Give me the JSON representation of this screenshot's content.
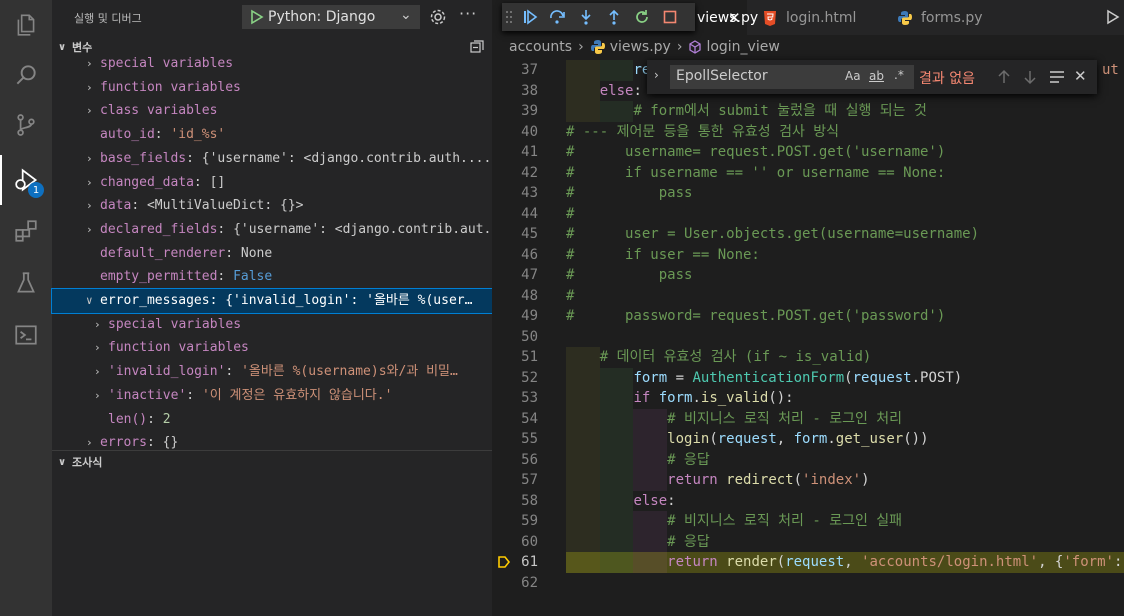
{
  "activity_bar": {
    "items": [
      {
        "name": "explorer",
        "icon": "files-icon"
      },
      {
        "name": "search",
        "icon": "search-icon"
      },
      {
        "name": "source-control",
        "icon": "source-control-icon"
      },
      {
        "name": "run-and-debug",
        "icon": "run-debug-icon",
        "badge": "1"
      },
      {
        "name": "extensions",
        "icon": "extensions-icon"
      },
      {
        "name": "testing",
        "icon": "flask-icon"
      },
      {
        "name": "remote-explorer",
        "icon": "terminal-icon"
      }
    ]
  },
  "sidebar": {
    "title": "실행 및 디버그",
    "config": "Python: Django",
    "variables_header": "변수",
    "watch_header": "조사식",
    "variables": [
      {
        "indent": 1,
        "twisty": ">",
        "name": "special variables",
        "value": "",
        "kind": "scope"
      },
      {
        "indent": 1,
        "twisty": ">",
        "name": "function variables",
        "value": "",
        "kind": "scope"
      },
      {
        "indent": 1,
        "twisty": ">",
        "name": "class variables",
        "value": "",
        "kind": "scope"
      },
      {
        "indent": 1,
        "twisty": "",
        "name": "auto_id",
        "value": "'id_%s'",
        "kind": "str"
      },
      {
        "indent": 1,
        "twisty": ">",
        "name": "base_fields",
        "value": "{'username': <django.contrib.auth....",
        "kind": "plain"
      },
      {
        "indent": 1,
        "twisty": ">",
        "name": "changed_data",
        "value": "[]",
        "kind": "plain"
      },
      {
        "indent": 1,
        "twisty": ">",
        "name": "data",
        "value": "<MultiValueDict: {}>",
        "kind": "plain"
      },
      {
        "indent": 1,
        "twisty": ">",
        "name": "declared_fields",
        "value": "{'username': <django.contrib.aut...",
        "kind": "plain"
      },
      {
        "indent": 1,
        "twisty": "",
        "name": "default_renderer",
        "value": "None",
        "kind": "plain"
      },
      {
        "indent": 1,
        "twisty": "",
        "name": "empty_permitted",
        "value": "False",
        "kind": "kw"
      },
      {
        "indent": 1,
        "twisty": "v",
        "name": "error_messages",
        "value": "{'invalid_login': '올바른 %(user…",
        "kind": "plain",
        "selected": true
      },
      {
        "indent": 2,
        "twisty": ">",
        "name": "special variables",
        "value": "",
        "kind": "scope"
      },
      {
        "indent": 2,
        "twisty": ">",
        "name": "function variables",
        "value": "",
        "kind": "scope"
      },
      {
        "indent": 2,
        "twisty": ">",
        "name": "'invalid_login'",
        "value": "'올바른 %(username)s와/과 비밀…",
        "kind": "str"
      },
      {
        "indent": 2,
        "twisty": ">",
        "name": "'inactive'",
        "value": "'이 계정은 유효하지 않습니다.'",
        "kind": "str"
      },
      {
        "indent": 2,
        "twisty": "",
        "name": "len()",
        "value": "2",
        "kind": "num"
      },
      {
        "indent": 1,
        "twisty": ">",
        "name": "errors",
        "value": "{}",
        "kind": "plain"
      }
    ]
  },
  "editor": {
    "tabs": [
      {
        "label": "views.py",
        "icon": "python-icon",
        "active": true
      },
      {
        "label": "login.html",
        "icon": "html-icon"
      },
      {
        "label": "forms.py",
        "icon": "python-icon"
      }
    ],
    "breadcrumb": [
      "accounts",
      "views.py",
      "login_view"
    ],
    "find": {
      "query": "EpollSelector",
      "options": [
        "Aa",
        "ab",
        ".*"
      ],
      "result": "결과 없음"
    },
    "lines": [
      {
        "n": "37",
        "tokens": [
          [
            "re",
            "var"
          ]
        ],
        "indent": 4,
        "tail": [
          [
            "ut",
            "str"
          ]
        ]
      },
      {
        "n": "38",
        "tokens": [
          [
            "else",
            "kw"
          ],
          [
            ":",
            "pl"
          ]
        ],
        "indent": 2
      },
      {
        "n": "39",
        "tokens": [
          [
            "# form에서 submit 눌렀을 때 실행 되는 것",
            "com"
          ]
        ],
        "indent": 4
      },
      {
        "n": "40",
        "tokens": [
          [
            "# --- 제어문 등을 통한 유효성 검사 방식",
            "com"
          ]
        ],
        "indent": 0
      },
      {
        "n": "41",
        "tokens": [
          [
            "#      username= request.POST.get('username')",
            "com"
          ]
        ],
        "indent": 0
      },
      {
        "n": "42",
        "tokens": [
          [
            "#      if username == '' or username == None:",
            "com"
          ]
        ],
        "indent": 0
      },
      {
        "n": "43",
        "tokens": [
          [
            "#          pass",
            "com"
          ]
        ],
        "indent": 0
      },
      {
        "n": "44",
        "tokens": [
          [
            "#",
            "com"
          ]
        ],
        "indent": 0
      },
      {
        "n": "45",
        "tokens": [
          [
            "#      user = User.objects.get(username=username)",
            "com"
          ]
        ],
        "indent": 0
      },
      {
        "n": "46",
        "tokens": [
          [
            "#      if user == None:",
            "com"
          ]
        ],
        "indent": 0
      },
      {
        "n": "47",
        "tokens": [
          [
            "#          pass",
            "com"
          ]
        ],
        "indent": 0
      },
      {
        "n": "48",
        "tokens": [
          [
            "#",
            "com"
          ]
        ],
        "indent": 0
      },
      {
        "n": "49",
        "tokens": [
          [
            "#      password= request.POST.get('password')",
            "com"
          ]
        ],
        "indent": 0
      },
      {
        "n": "50",
        "tokens": [],
        "indent": 0
      },
      {
        "n": "51",
        "tokens": [
          [
            "# 데이터 유효성 검사 (if ~ is_valid)",
            "com"
          ]
        ],
        "indent": 2
      },
      {
        "n": "52",
        "tokens": [
          [
            "form",
            "var"
          ],
          [
            " = ",
            "pl"
          ],
          [
            "AuthenticationForm",
            "cls"
          ],
          [
            "(",
            "pl"
          ],
          [
            "request",
            "var"
          ],
          [
            ".POST)",
            "pl"
          ]
        ],
        "indent": 4
      },
      {
        "n": "53",
        "tokens": [
          [
            "if ",
            "kw"
          ],
          [
            "form",
            "var"
          ],
          [
            ".",
            "pl"
          ],
          [
            "is_valid",
            "fn"
          ],
          [
            "():",
            "pl"
          ]
        ],
        "indent": 4
      },
      {
        "n": "54",
        "tokens": [
          [
            "# 비지니스 로직 처리 - 로그인 처리",
            "com"
          ]
        ],
        "indent": 6
      },
      {
        "n": "55",
        "tokens": [
          [
            "login",
            "fn"
          ],
          [
            "(",
            "pl"
          ],
          [
            "request",
            "var"
          ],
          [
            ", ",
            "pl"
          ],
          [
            "form",
            "var"
          ],
          [
            ".",
            "pl"
          ],
          [
            "get_user",
            "fn"
          ],
          [
            "())",
            "pl"
          ]
        ],
        "indent": 6
      },
      {
        "n": "56",
        "tokens": [
          [
            "# 응답",
            "com"
          ]
        ],
        "indent": 6
      },
      {
        "n": "57",
        "tokens": [
          [
            "return ",
            "kw"
          ],
          [
            "redirect",
            "fn"
          ],
          [
            "(",
            "pl"
          ],
          [
            "'index'",
            "str"
          ],
          [
            ")",
            "pl"
          ]
        ],
        "indent": 6
      },
      {
        "n": "58",
        "tokens": [
          [
            "else",
            "kw"
          ],
          [
            ":",
            "pl"
          ]
        ],
        "indent": 4
      },
      {
        "n": "59",
        "tokens": [
          [
            "# 비지니스 로직 처리 - 로그인 실패",
            "com"
          ]
        ],
        "indent": 6
      },
      {
        "n": "60",
        "tokens": [
          [
            "# 응답",
            "com"
          ]
        ],
        "indent": 6
      },
      {
        "n": "61",
        "tokens": [
          [
            "return ",
            "kw"
          ],
          [
            "render",
            "fn"
          ],
          [
            "(",
            "pl"
          ],
          [
            "request",
            "var"
          ],
          [
            ", ",
            "pl"
          ],
          [
            "'accounts/login.html'",
            "str"
          ],
          [
            ", {",
            "pl"
          ],
          [
            "'form'",
            "str"
          ],
          [
            ":",
            "pl"
          ]
        ],
        "indent": 6,
        "current": true
      },
      {
        "n": "62",
        "tokens": [],
        "indent": 0
      }
    ]
  }
}
